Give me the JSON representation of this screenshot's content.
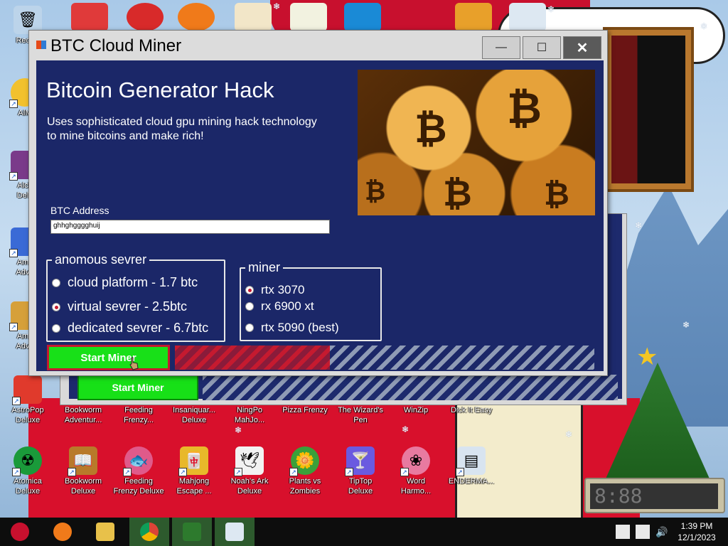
{
  "window": {
    "title": "BTC Cloud Miner",
    "minimize_glyph": "—",
    "maximize_glyph": "☐",
    "close_glyph": "✕"
  },
  "app": {
    "heading": "Bitcoin Generator Hack",
    "description": "Uses sophisticated cloud gpu mining hack technology to mine bitcoins and make rich!",
    "address_label": "BTC Address",
    "address_value": "ghhghgggghuij",
    "server_group": {
      "legend": "anomous sevrer",
      "options": [
        {
          "label": "cloud platform - 1.7 btc",
          "checked": false
        },
        {
          "label": "virtual sevrer - 2.5btc",
          "checked": true
        },
        {
          "label": "dedicated sevrer - 6.7btc",
          "checked": false
        }
      ]
    },
    "miner_group": {
      "legend": "miner",
      "options": [
        {
          "label": "rtx 3070",
          "checked": true
        },
        {
          "label": "rx 6900 xt",
          "checked": false
        },
        {
          "label": "rtx 5090 (best)",
          "checked": false
        }
      ]
    },
    "start_label": "Start Miner",
    "progress_fraction": 0.37
  },
  "background_window": {
    "start_label": "Start Miner"
  },
  "desktop_icons_row1": [
    {
      "label": "AstroPop\nDeluxe",
      "icon": "astropop-icon",
      "color": "#e03a2c"
    },
    {
      "label": "Bookworm\nAdventur...",
      "icon": "bookworm-icon",
      "color": "#6b8f2a"
    },
    {
      "label": "Feeding\nFrenzy...",
      "icon": "fish-icon",
      "color": "#e06a9a"
    },
    {
      "label": "Insaniquar...\nDeluxe",
      "icon": "insaniquarium-icon",
      "color": "#2a7ad6"
    },
    {
      "label": "NingPo\nMahJo...",
      "icon": "mahjong-icon",
      "color": "#c8102e"
    },
    {
      "label": "Pizza Frenzy",
      "icon": "pizza-icon",
      "color": "#d88a2a"
    },
    {
      "label": "The Wizard's\nPen",
      "icon": "wizard-icon",
      "color": "#7a4ad6"
    },
    {
      "label": "WinZip",
      "icon": "winzip-icon",
      "color": "#e8c14a"
    },
    {
      "label": "Dick It Easy",
      "icon": "game-icon",
      "color": "#4a8ad6"
    }
  ],
  "desktop_icons_row2": [
    {
      "label": "Atomica\nDeluxe",
      "icon": "atomica-icon",
      "color": "#1a9a3a"
    },
    {
      "label": "Bookworm\nDeluxe",
      "icon": "bookworm-deluxe-icon",
      "color": "#b87a2a"
    },
    {
      "label": "Feeding\nFrenzy Deluxe",
      "icon": "feeding-frenzy-icon",
      "color": "#e05a8a"
    },
    {
      "label": "Mahjong\nEscape ...",
      "icon": "mahjong-escape-icon",
      "color": "#e8b82a"
    },
    {
      "label": "Noah's Ark\nDeluxe",
      "icon": "dove-icon",
      "color": "#f2f2f2"
    },
    {
      "label": "Plants vs\nZombies",
      "icon": "flower-icon",
      "color": "#3aa03a"
    },
    {
      "label": "TipTop\nDeluxe",
      "icon": "cocktail-icon",
      "color": "#6a5ae0"
    },
    {
      "label": "Word\nHarmo...",
      "icon": "word-harmony-icon",
      "color": "#e87aa0"
    },
    {
      "label": "ENDERMA...",
      "icon": "document-icon",
      "color": "#d8e4f0"
    }
  ],
  "desktop_icons_left": [
    {
      "label": "Recycl",
      "icon": "recycle-bin-icon",
      "color": "#bcd4ea"
    },
    {
      "label": "AIM",
      "icon": "aim-icon",
      "color": "#f2c12e"
    },
    {
      "label": "Alch\nDelu",
      "icon": "alchemy-icon",
      "color": "#7a3a8a"
    },
    {
      "label": "Ama\nAdve",
      "icon": "amazing-adventures-icon",
      "color": "#3a6ad6"
    },
    {
      "label": "Ama\nAdve",
      "icon": "amazing-adventures2-icon",
      "color": "#d6a03a"
    }
  ],
  "taskbar": {
    "time": "1:39 PM",
    "date": "12/1/2023"
  },
  "colors": {
    "client_bg": "#1b2768",
    "start_green": "#18e018",
    "accent_red": "#c51a2f"
  }
}
